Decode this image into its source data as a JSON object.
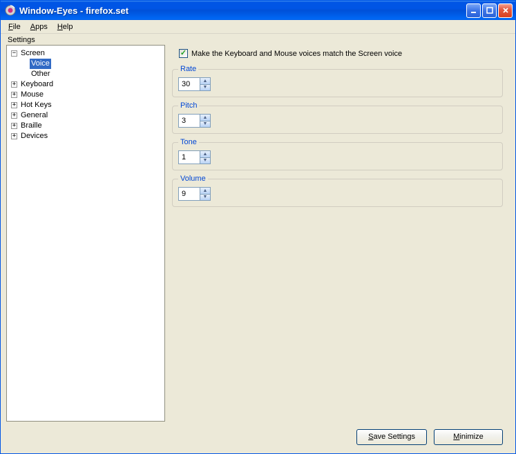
{
  "window": {
    "title": "Window-Eyes - firefox.set"
  },
  "menu": {
    "file": "File",
    "apps": "Apps",
    "help": "Help"
  },
  "panel_heading": "Settings",
  "tree": {
    "screen": "Screen",
    "voice": "Voice",
    "other": "Other",
    "keyboard": "Keyboard",
    "mouse": "Mouse",
    "hotkeys": "Hot Keys",
    "general": "General",
    "braille": "Braille",
    "devices": "Devices"
  },
  "checkbox_label": "Make the Keyboard and Mouse voices match the Screen voice",
  "groups": {
    "rate": {
      "label": "Rate",
      "value": "30"
    },
    "pitch": {
      "label": "Pitch",
      "value": "3"
    },
    "tone": {
      "label": "Tone",
      "value": "1"
    },
    "volume": {
      "label": "Volume",
      "value": "9"
    }
  },
  "buttons": {
    "save": "Save Settings",
    "minimize": "Minimize"
  }
}
